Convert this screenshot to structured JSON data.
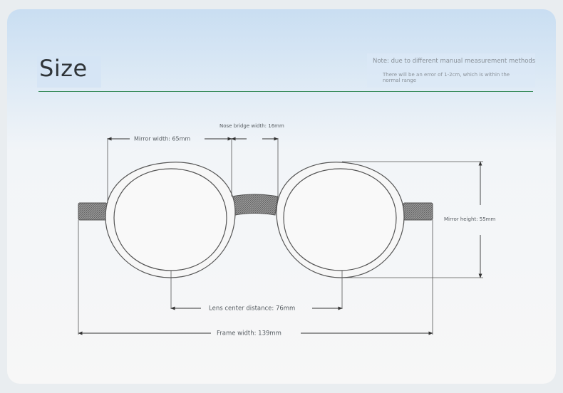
{
  "header": {
    "title": "Size",
    "note_line1": "Note: due to different manual measurement methods",
    "note_line2": "There will be an error of 1-2cm, which is within the normal range"
  },
  "dimensions": {
    "mirror_width": "Mirror width: 65mm",
    "nose_bridge_width": "Nose bridge width: 16mm",
    "mirror_height": "Mirror height: 55mm",
    "lens_center_distance": "Lens center distance: 76mm",
    "frame_width": "Frame width: 139mm"
  },
  "colors": {
    "accent_rule": "#3b8d5d",
    "line": "#555555"
  }
}
